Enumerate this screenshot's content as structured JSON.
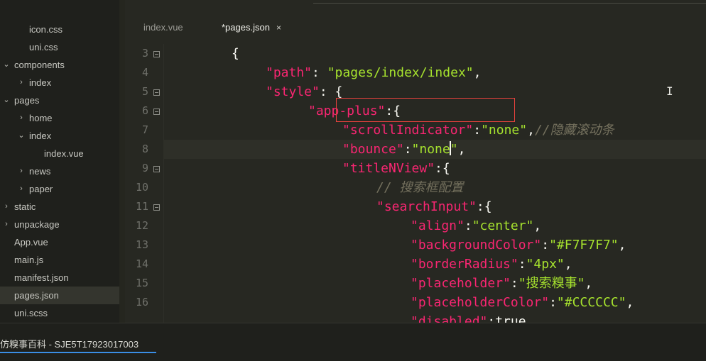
{
  "sidebar": {
    "items": [
      {
        "label": "icon.css",
        "chevron": ""
      },
      {
        "label": "uni.css",
        "chevron": ""
      },
      {
        "label": "components",
        "chevron": "⌄"
      },
      {
        "label": "index",
        "chevron": "›"
      },
      {
        "label": "pages",
        "chevron": "⌄"
      },
      {
        "label": "home",
        "chevron": "›"
      },
      {
        "label": "index",
        "chevron": "⌄"
      },
      {
        "label": "index.vue",
        "chevron": ""
      },
      {
        "label": "news",
        "chevron": "›"
      },
      {
        "label": "paper",
        "chevron": "›"
      },
      {
        "label": "static",
        "chevron": "›"
      },
      {
        "label": "unpackage",
        "chevron": "›"
      },
      {
        "label": "App.vue",
        "chevron": ""
      },
      {
        "label": "main.js",
        "chevron": ""
      },
      {
        "label": "manifest.json",
        "chevron": ""
      },
      {
        "label": "pages.json",
        "chevron": ""
      },
      {
        "label": "uni.scss",
        "chevron": ""
      }
    ],
    "selected": "pages.json"
  },
  "tabs": [
    {
      "label": "index.vue",
      "active": false
    },
    {
      "label": "*pages.json",
      "active": true,
      "close": "×"
    }
  ],
  "editor": {
    "lines": [
      {
        "n": "3",
        "fold": true,
        "tokens": [
          [
            "p",
            "{"
          ]
        ]
      },
      {
        "n": "4",
        "fold": false,
        "tokens": [
          [
            "k",
            "\"path\""
          ],
          [
            "p",
            ": "
          ],
          [
            "s",
            "\"pages/index/index\""
          ],
          [
            "p",
            ","
          ]
        ]
      },
      {
        "n": "5",
        "fold": true,
        "tokens": [
          [
            "k",
            "\"style\""
          ],
          [
            "p",
            ": {"
          ]
        ]
      },
      {
        "n": "6",
        "fold": true,
        "tokens": [
          [
            "k",
            "\"app-plus\""
          ],
          [
            "p",
            ":{"
          ]
        ]
      },
      {
        "n": "7",
        "fold": false,
        "tokens": [
          [
            "k",
            "\"scrollIndicator\""
          ],
          [
            "p",
            ":"
          ],
          [
            "s",
            "\"none\""
          ],
          [
            "p",
            ","
          ],
          [
            "c",
            "//隐藏滚动条"
          ]
        ]
      },
      {
        "n": "8",
        "fold": false,
        "current": true,
        "tokens": [
          [
            "k",
            "\"bounce\""
          ],
          [
            "p",
            ":"
          ],
          [
            "s",
            "\"none"
          ],
          [
            "cursor",
            ""
          ],
          [
            "s",
            "\""
          ],
          [
            "p",
            ","
          ]
        ]
      },
      {
        "n": "9",
        "fold": true,
        "tokens": [
          [
            "k",
            "\"titleNView\""
          ],
          [
            "p",
            ":{"
          ]
        ]
      },
      {
        "n": "10",
        "fold": false,
        "tokens": [
          [
            "c",
            "// 搜索框配置"
          ]
        ]
      },
      {
        "n": "11",
        "fold": true,
        "tokens": [
          [
            "k",
            "\"searchInput\""
          ],
          [
            "p",
            ":{"
          ]
        ]
      },
      {
        "n": "12",
        "fold": false,
        "tokens": [
          [
            "k",
            "\"align\""
          ],
          [
            "p",
            ":"
          ],
          [
            "s",
            "\"center\""
          ],
          [
            "p",
            ","
          ]
        ]
      },
      {
        "n": "13",
        "fold": false,
        "tokens": [
          [
            "k",
            "\"backgroundColor\""
          ],
          [
            "p",
            ":"
          ],
          [
            "s",
            "\"#F7F7F7\""
          ],
          [
            "p",
            ","
          ]
        ]
      },
      {
        "n": "14",
        "fold": false,
        "tokens": [
          [
            "k",
            "\"borderRadius\""
          ],
          [
            "p",
            ":"
          ],
          [
            "s",
            "\"4px\""
          ],
          [
            "p",
            ","
          ]
        ]
      },
      {
        "n": "15",
        "fold": false,
        "tokens": [
          [
            "k",
            "\"placeholder\""
          ],
          [
            "p",
            ":"
          ],
          [
            "s",
            "\"搜索糗事\""
          ],
          [
            "p",
            ","
          ]
        ]
      },
      {
        "n": "16",
        "fold": false,
        "tokens": [
          [
            "k",
            "\"placeholderColor\""
          ],
          [
            "p",
            ":"
          ],
          [
            "s",
            "\"#CCCCCC\""
          ],
          [
            "p",
            ","
          ]
        ]
      },
      {
        "n": "",
        "fold": false,
        "tokens": [
          [
            "k",
            "\"disabled\""
          ],
          [
            "p",
            ":true,"
          ]
        ]
      }
    ]
  },
  "statusbar": {
    "project": "仿糗事百科 - SJE5T17923017003"
  },
  "colors": {
    "keyword": "#f92672",
    "string": "#a6e22e",
    "comment": "#75715e",
    "highlight_box": "#e8423d",
    "accent": "#3a8ee6"
  }
}
